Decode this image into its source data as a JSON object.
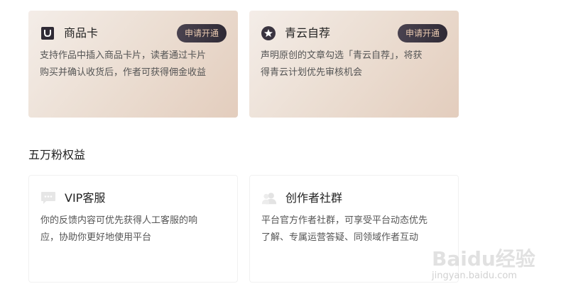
{
  "top_cards": [
    {
      "icon": "shopping-bag-icon",
      "title": "商品卡",
      "button": "申请开通",
      "desc_line1": "支持作品中插入商品卡片，读者通过卡片",
      "desc_line2": "购买并确认收货后，作者可获得佣金收益"
    },
    {
      "icon": "star-badge-icon",
      "title": "青云自荐",
      "button": "申请开通",
      "desc_line1": "声明原创的文章勾选「青云自荐」，将获",
      "desc_line2": "得青云计划优先审核机会"
    }
  ],
  "section": {
    "title": "五万粉权益"
  },
  "bottom_cards": [
    {
      "icon": "chat-bubble-icon",
      "title": "VIP客服",
      "desc_line1": "你的反馈内容可优先获得人工客服的响",
      "desc_line2": "应，协助你更好地使用平台"
    },
    {
      "icon": "users-icon",
      "title": "创作者社群",
      "desc_line1": "平台官方作者社群，可享受平台动态优先",
      "desc_line2": "了解、专属运营答疑、同领域作者互动"
    }
  ],
  "watermark": {
    "main": "Baidu经验",
    "sub": "jingyan.baidu.com"
  },
  "colors": {
    "button_bg": "#38323e",
    "button_text": "#e9c9b0",
    "card_gold_from": "#f4ede8",
    "card_gold_to": "#e3cdbd"
  }
}
